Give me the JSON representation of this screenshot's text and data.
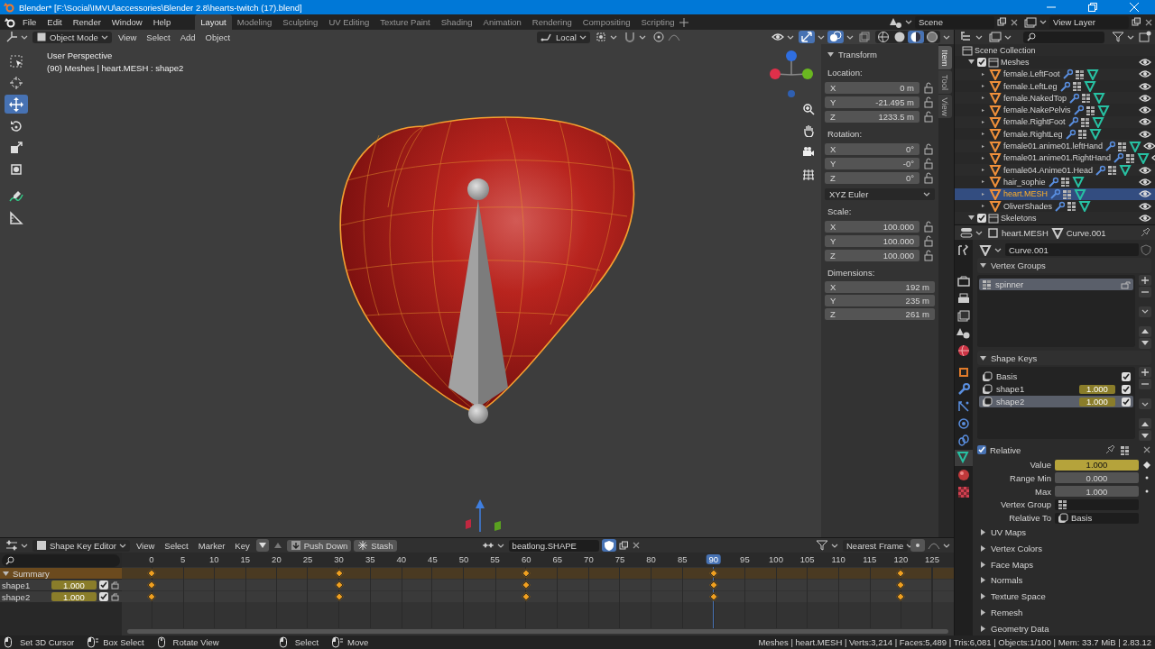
{
  "window": {
    "title": "Blender* [F:\\Social\\IMVU\\accessories\\Blender 2.8\\hearts-twitch (17).blend]"
  },
  "menu": [
    "File",
    "Edit",
    "Render",
    "Window",
    "Help"
  ],
  "workspaces": [
    {
      "label": "Layout",
      "selected": true
    },
    {
      "label": "Modeling",
      "selected": false
    },
    {
      "label": "Sculpting",
      "selected": false
    },
    {
      "label": "UV Editing",
      "selected": false
    },
    {
      "label": "Texture Paint",
      "selected": false
    },
    {
      "label": "Shading",
      "selected": false
    },
    {
      "label": "Animation",
      "selected": false
    },
    {
      "label": "Rendering",
      "selected": false
    },
    {
      "label": "Compositing",
      "selected": false
    },
    {
      "label": "Scripting",
      "selected": false
    }
  ],
  "scene": "Scene",
  "view_layer": "View Layer",
  "viewport": {
    "mode": "Object Mode",
    "menus": [
      "View",
      "Select",
      "Add",
      "Object"
    ],
    "orientation": "Local",
    "shading_modes": [
      {
        "kind": "wireframe",
        "selected": false
      },
      {
        "kind": "solid",
        "selected": false
      },
      {
        "kind": "material",
        "selected": true
      },
      {
        "kind": "rendered",
        "selected": false
      }
    ],
    "overlay_lines": [
      "User Perspective",
      "(90) Meshes | heart.MESH : shape2"
    ],
    "tools": [
      {
        "kind": "select",
        "selected": false
      },
      {
        "kind": "cursor",
        "selected": false
      },
      {
        "kind": "move",
        "selected": true
      },
      {
        "kind": "rotate",
        "selected": false
      },
      {
        "kind": "scale",
        "selected": false
      },
      {
        "kind": "transform",
        "selected": false
      },
      {
        "kind": "annotate",
        "selected": false
      },
      {
        "kind": "measure",
        "selected": false
      }
    ],
    "sidebar_tabs": [
      {
        "label": "Item",
        "selected": true
      },
      {
        "label": "Tool",
        "selected": false
      },
      {
        "label": "View",
        "selected": false
      }
    ],
    "transform": {
      "title": "Transform",
      "groups": [
        {
          "label": "Location:",
          "locks": true,
          "fields": [
            {
              "axis": "X",
              "value": "0 m"
            },
            {
              "axis": "Y",
              "value": "-21.495 m"
            },
            {
              "axis": "Z",
              "value": "1233.5 m"
            }
          ]
        },
        {
          "label": "Rotation:",
          "locks": true,
          "fields": [
            {
              "axis": "X",
              "value": "0°"
            },
            {
              "axis": "Y",
              "value": "-0°"
            },
            {
              "axis": "Z",
              "value": "0°"
            }
          ],
          "mode": "XYZ Euler"
        },
        {
          "label": "Scale:",
          "locks": true,
          "fields": [
            {
              "axis": "X",
              "value": "100.000"
            },
            {
              "axis": "Y",
              "value": "100.000"
            },
            {
              "axis": "Z",
              "value": "100.000"
            }
          ]
        },
        {
          "label": "Dimensions:",
          "locks": false,
          "fields": [
            {
              "axis": "X",
              "value": "192 m"
            },
            {
              "axis": "Y",
              "value": "235 m"
            },
            {
              "axis": "Z",
              "value": "261 m"
            }
          ]
        }
      ]
    }
  },
  "outliner": {
    "root": "Scene Collection",
    "items": [
      {
        "label": "Meshes",
        "kind": "collection",
        "expanded": true,
        "checked": true,
        "children": [
          {
            "label": "female.LeftFoot",
            "kind": "mesh",
            "expanded": false,
            "selected": false
          },
          {
            "label": "female.LeftLeg",
            "kind": "mesh",
            "expanded": false,
            "selected": false
          },
          {
            "label": "female.NakedTop",
            "kind": "mesh",
            "expanded": false,
            "selected": false
          },
          {
            "label": "female.NakePelvis",
            "kind": "mesh",
            "expanded": false,
            "selected": false
          },
          {
            "label": "female.RightFoot",
            "kind": "mesh",
            "expanded": false,
            "selected": false
          },
          {
            "label": "female.RightLeg",
            "kind": "mesh",
            "expanded": false,
            "selected": false
          },
          {
            "label": "female01.anime01.leftHand",
            "kind": "mesh",
            "expanded": false,
            "selected": false
          },
          {
            "label": "female01.anime01.RightHand",
            "kind": "mesh",
            "expanded": false,
            "selected": false
          },
          {
            "label": "female04.Anime01.Head",
            "kind": "mesh",
            "expanded": false,
            "selected": false
          },
          {
            "label": "hair_sophie",
            "kind": "mesh",
            "expanded": false,
            "selected": false
          },
          {
            "label": "heart.MESH",
            "kind": "mesh",
            "expanded": false,
            "selected": true
          },
          {
            "label": "OliverShades",
            "kind": "mesh",
            "expanded": false,
            "selected": false
          }
        ]
      },
      {
        "label": "Skeletons",
        "kind": "collection",
        "expanded": true,
        "checked": true
      }
    ]
  },
  "properties": {
    "object": "heart.MESH",
    "data": "Curve.001",
    "datablock": "Curve.001",
    "tabs": [
      {
        "kind": "tool",
        "selected": false
      },
      {
        "kind": "render",
        "selected": false
      },
      {
        "kind": "output",
        "selected": false
      },
      {
        "kind": "view_layer",
        "selected": false
      },
      {
        "kind": "scene",
        "selected": false
      },
      {
        "kind": "world",
        "selected": false
      },
      {
        "kind": "object",
        "selected": false
      },
      {
        "kind": "modifiers",
        "selected": false
      },
      {
        "kind": "particles",
        "selected": false
      },
      {
        "kind": "physics",
        "selected": false
      },
      {
        "kind": "constraints",
        "selected": false
      },
      {
        "kind": "data",
        "selected": true
      },
      {
        "kind": "material",
        "selected": false
      },
      {
        "kind": "texture",
        "selected": false
      }
    ],
    "vertex_groups": {
      "title": "Vertex Groups",
      "expanded": true,
      "items": [
        {
          "name": "spinner",
          "selected": true
        }
      ]
    },
    "shape_keys": {
      "title": "Shape Keys",
      "expanded": true,
      "items": [
        {
          "name": "Basis",
          "checked": true,
          "selected": false
        },
        {
          "name": "shape1",
          "value": "1.000",
          "checked": true,
          "selected": false
        },
        {
          "name": "shape2",
          "value": "1.000",
          "checked": true,
          "selected": true
        }
      ],
      "relative": {
        "label": "Relative",
        "checked": true
      },
      "fields": [
        {
          "label": "Value",
          "kind": "animated",
          "value": "1.000"
        },
        {
          "label": "Range Min",
          "kind": "number",
          "value": "0.000"
        },
        {
          "label": "Max",
          "kind": "number",
          "value": "1.000"
        },
        {
          "label": "Vertex Group",
          "kind": "vertex-group"
        },
        {
          "label": "Relative To",
          "kind": "shape-key",
          "value": "Basis"
        }
      ]
    },
    "panels": [
      {
        "title": "UV Maps",
        "expanded": false
      },
      {
        "title": "Vertex Colors",
        "expanded": false
      },
      {
        "title": "Face Maps",
        "expanded": false
      },
      {
        "title": "Normals",
        "expanded": false
      },
      {
        "title": "Texture Space",
        "expanded": false
      },
      {
        "title": "Remesh",
        "expanded": false
      },
      {
        "title": "Geometry Data",
        "expanded": false
      }
    ]
  },
  "dopesheet": {
    "editor": "Shape Key Editor",
    "menus": [
      "View",
      "Select",
      "Marker",
      "Key"
    ],
    "buttons": [
      {
        "kind": "push-down",
        "label": "Push Down"
      },
      {
        "kind": "stash",
        "label": "Stash"
      }
    ],
    "action": "beatlong.SHAPE",
    "snap": "Nearest Frame",
    "ticks": [
      {
        "label": "0",
        "key": true,
        "selected": false
      },
      {
        "label": "5",
        "key": false,
        "selected": false
      },
      {
        "label": "10",
        "key": false,
        "selected": false
      },
      {
        "label": "15",
        "key": false,
        "selected": false
      },
      {
        "label": "20",
        "key": false,
        "selected": false
      },
      {
        "label": "25",
        "key": false,
        "selected": false
      },
      {
        "label": "30",
        "key": true,
        "selected": false
      },
      {
        "label": "35",
        "key": false,
        "selected": false
      },
      {
        "label": "40",
        "key": false,
        "selected": false
      },
      {
        "label": "45",
        "key": false,
        "selected": false
      },
      {
        "label": "50",
        "key": false,
        "selected": false
      },
      {
        "label": "55",
        "key": false,
        "selected": false
      },
      {
        "label": "60",
        "key": true,
        "selected": false
      },
      {
        "label": "65",
        "key": false,
        "selected": false
      },
      {
        "label": "70",
        "key": false,
        "selected": false
      },
      {
        "label": "75",
        "key": false,
        "selected": false
      },
      {
        "label": "80",
        "key": false,
        "selected": false
      },
      {
        "label": "85",
        "key": false,
        "selected": false
      },
      {
        "label": "90",
        "key": true,
        "selected": true
      },
      {
        "label": "95",
        "key": false,
        "selected": false
      },
      {
        "label": "100",
        "key": false,
        "selected": false
      },
      {
        "label": "105",
        "key": false,
        "selected": false
      },
      {
        "label": "110",
        "key": false,
        "selected": false
      },
      {
        "label": "115",
        "key": false,
        "selected": false
      },
      {
        "label": "120",
        "key": true,
        "selected": false
      },
      {
        "label": "125",
        "key": false,
        "selected": false
      }
    ],
    "channels": [
      {
        "name": "Summary",
        "kind": "summary",
        "expanded": true
      },
      {
        "name": "shape1",
        "kind": "shape",
        "value": "1.000",
        "checked": true
      },
      {
        "name": "shape2",
        "kind": "shape",
        "value": "1.000",
        "checked": true
      }
    ]
  },
  "status": {
    "hint_groups": [
      [
        {
          "kind": "left-click",
          "label": "Set 3D Cursor"
        },
        {
          "kind": "drag",
          "label": "Box Select"
        },
        {
          "kind": "middle",
          "label": "Rotate View"
        }
      ],
      [
        {
          "kind": "left-click",
          "label": "Select"
        },
        {
          "kind": "drag",
          "label": "Move"
        }
      ]
    ],
    "stats": "Meshes | heart.MESH | Verts:3,214 | Faces:5,489 | Tris:6,081 | Objects:1/100 | Mem: 33.7 MiB | 2.83.12"
  }
}
